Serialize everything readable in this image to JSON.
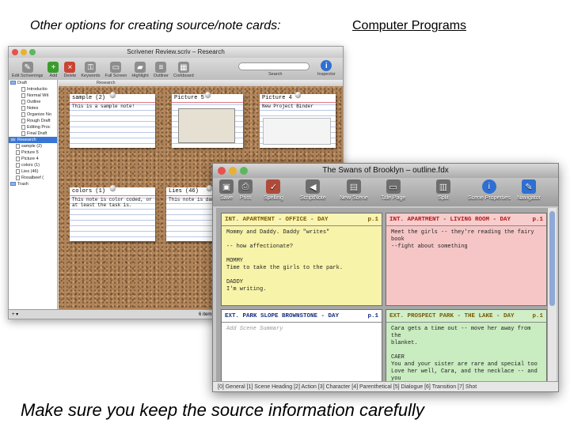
{
  "slide": {
    "heading_left": "Other options for creating source/note cards:",
    "heading_right": "Computer Programs",
    "caption": "Make sure you keep the source information carefully"
  },
  "scrivener": {
    "title": "Scrivener Review.scriv – Research",
    "toolbar": [
      {
        "label": "Edit Scrivenings",
        "icon": "pencil-icon"
      },
      {
        "label": "Add",
        "icon": "add-icon",
        "color": "#3a9c2d"
      },
      {
        "label": "Delete",
        "icon": "delete-icon",
        "color": "#c94434"
      },
      {
        "label": "Keywords",
        "icon": "keywords-icon"
      },
      {
        "label": "Full Screen",
        "icon": "full-screen-icon"
      },
      {
        "label": "Highlight",
        "icon": "highlight-icon"
      },
      {
        "label": "Outliner",
        "icon": "outliner-icon"
      },
      {
        "label": "Corkboard",
        "icon": "corkboard-icon"
      }
    ],
    "search_label": "Search",
    "inspector_label": "Inspector",
    "path": "Research",
    "binder": [
      {
        "label": "Draft",
        "type": "folder",
        "level": 0
      },
      {
        "label": "Introductio",
        "type": "doc",
        "level": 2
      },
      {
        "label": "Normal Wit",
        "type": "doc",
        "level": 2
      },
      {
        "label": "Outline",
        "type": "doc",
        "level": 2
      },
      {
        "label": "Notes",
        "type": "doc",
        "level": 2
      },
      {
        "label": "Organize No",
        "type": "doc",
        "level": 2
      },
      {
        "label": "Rough Draft",
        "type": "doc",
        "level": 2
      },
      {
        "label": "Editing Proc",
        "type": "doc",
        "level": 2
      },
      {
        "label": "Final Draft",
        "type": "doc",
        "level": 2
      },
      {
        "label": "Research",
        "type": "folder",
        "level": 0,
        "selected": true
      },
      {
        "label": "sample (2)",
        "type": "doc",
        "level": 1
      },
      {
        "label": "Picture 5",
        "type": "doc",
        "level": 1
      },
      {
        "label": "Picture 4",
        "type": "doc",
        "level": 1
      },
      {
        "label": "colors (1)",
        "type": "doc",
        "level": 1
      },
      {
        "label": "Lies (46)",
        "type": "doc",
        "level": 1
      },
      {
        "label": "Rosalbeef (",
        "type": "doc",
        "level": 1
      },
      {
        "label": "Trash",
        "type": "folder",
        "level": 0
      }
    ],
    "cards": [
      {
        "title": "sample (2)",
        "body": "This is a sample note!"
      },
      {
        "title": "Picture 5",
        "body": ""
      },
      {
        "title": "Picture 4",
        "body": "New Project Binder"
      },
      {
        "title": "colors (1)",
        "body": "This note is color coded, or at least the task is."
      },
      {
        "title": "Lies (46)",
        "body": "This note is dama"
      }
    ],
    "status": "6 items"
  },
  "finaldraft": {
    "title": "The Swans of Brooklyn – outline.fdx",
    "toolbar": [
      {
        "label": "Save",
        "icon": "save-icon"
      },
      {
        "label": "Print",
        "icon": "print-icon"
      },
      {
        "label": "Spelling",
        "icon": "spelling-icon"
      },
      {
        "label": "ScriptNote",
        "icon": "scriptnote-icon"
      },
      {
        "label": "New Scene",
        "icon": "new-scene-icon"
      },
      {
        "label": "Title Page",
        "icon": "title-page-icon"
      },
      {
        "label": "Split",
        "icon": "split-icon"
      },
      {
        "label": "Scene Properties",
        "icon": "info-icon"
      },
      {
        "label": "Navigator",
        "icon": "navigator-icon"
      }
    ],
    "scenes": [
      {
        "heading": "INT. APARTMENT - OFFICE - DAY",
        "page": "p.1",
        "color": "#f7f3a8",
        "head_color": "#7a5a00",
        "lines": [
          "Mommy and Daddy. Daddy \"writes\"",
          "",
          "-- how affectionate?",
          "",
          "MOMMY",
          "Time to take the girls to the park.",
          "",
          "DADDY",
          "I'm writing."
        ]
      },
      {
        "heading": "INT. APARTMENT - LIVING ROOM - DAY",
        "page": "p.1",
        "color": "#f6c6c6",
        "head_color": "#b01818",
        "lines": [
          "Meet the girls -- they're reading the fairy book",
          "--fight about something"
        ]
      },
      {
        "heading": "EXT. PARK SLOPE BROWNSTONE - DAY",
        "page": "p.1",
        "color": "#ffffff",
        "head_color": "#1a2f80",
        "lines": [
          "Add Scene Summary"
        ]
      },
      {
        "heading": "EXT. PROSPECT PARK - THE LAKE - DAY",
        "page": "p.1",
        "color": "#c9ecc0",
        "head_color": "#7a5a00",
        "lines": [
          "Cara gets a time out -- move her away from the",
          "blanket.",
          "",
          "CAER",
          "You and your sister are rare and special too",
          "Love her well, Cara, and the necklace -- and you",
          "-- will shine."
        ]
      }
    ],
    "elements_bar": "[0] General  [1] Scene Heading  [2] Action  [3] Character  [4] Parenthetical  [5] Dialogue  [6] Transition  [7] Shot"
  }
}
